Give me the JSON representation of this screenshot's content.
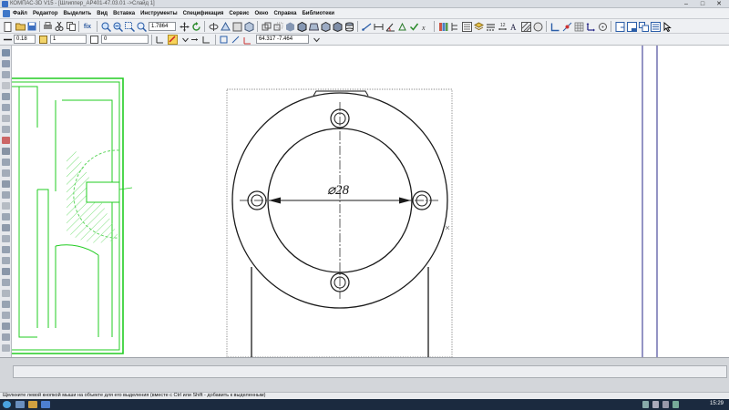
{
  "window": {
    "title": "КОМПАС-3D V15 - [Шлиппер_АР401-47.03.01 ->Слайд 1]",
    "min_glyph": "–",
    "max_glyph": "□",
    "close_glyph": "✕"
  },
  "menu": {
    "items": [
      "Файл",
      "Редактор",
      "Выделить",
      "Вид",
      "Вставка",
      "Инструменты",
      "Спецификация",
      "Сервис",
      "Окно",
      "Справка",
      "Библиотеки"
    ]
  },
  "toolbar": {
    "zoom_value": "1.7864",
    "style_value": "0.18",
    "layer_value": "1",
    "state_value": "0",
    "coords_value": "64.317 -7.464",
    "zoom_extents_label": "fix"
  },
  "drawing": {
    "dimension_text": "⌀28",
    "colors": {
      "line": "#1a1a1a",
      "green": "#22cc22",
      "hatch": "#7ee07e",
      "frame": "#2a2a8a"
    }
  },
  "status": {
    "message": "Щелкните левой кнопкой мыши на объекте для его выделения (вместе с Ctrl или Shift - добавить к выделенным)"
  },
  "taskbar": {
    "clock": "15:29"
  }
}
